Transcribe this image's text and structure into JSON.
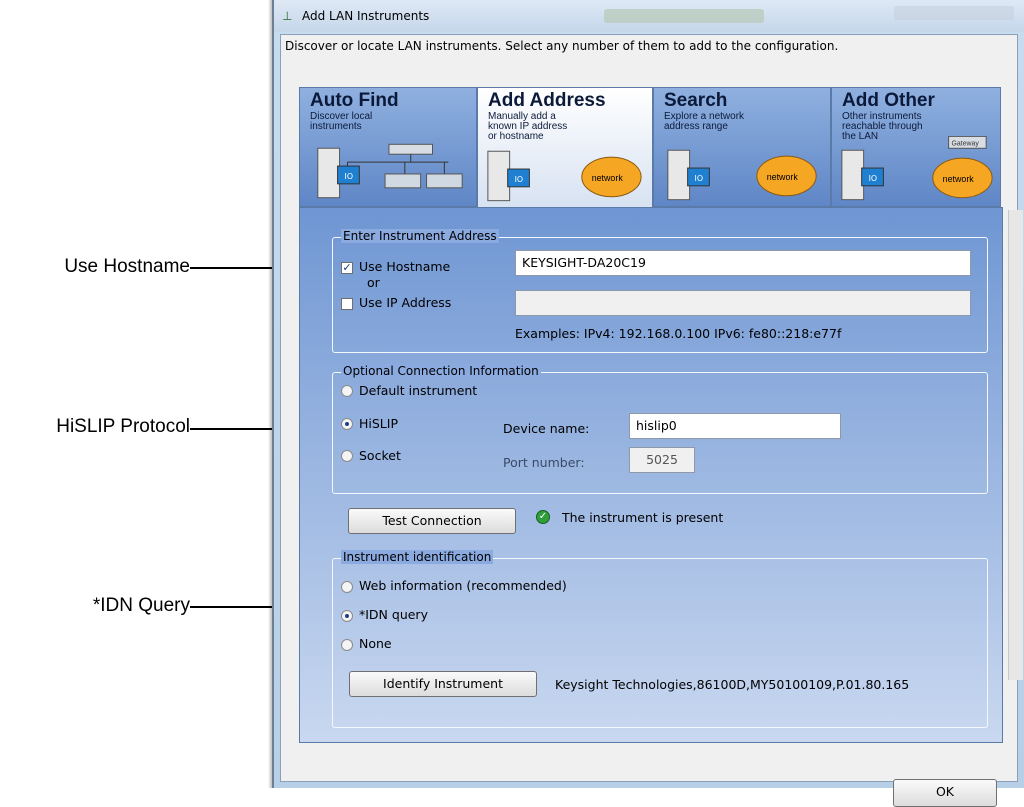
{
  "callouts": {
    "use_hostname": "Use Hostname",
    "hislip": "HiSLIP Protocol",
    "idn": "*IDN Query"
  },
  "window": {
    "title": "Add LAN Instruments",
    "description": "Discover or locate LAN instruments. Select any number of them to add to the configuration."
  },
  "tabs": [
    {
      "name": "Auto Find",
      "subtitle": "Discover local instruments",
      "icon": "auto-find-illustration"
    },
    {
      "name": "Add Address",
      "subtitle": "Manually add a known IP address or hostname",
      "icon": "add-address-illustration"
    },
    {
      "name": "Search",
      "subtitle": "Explore a network address range",
      "icon": "search-illustration"
    },
    {
      "name": "Add Other",
      "subtitle": "Other instruments reachable through the LAN",
      "icon": "add-other-illustration"
    }
  ],
  "illustration_labels": {
    "network": "network",
    "gateway": "Gateway",
    "io": "IO"
  },
  "address_group": {
    "title": "Enter Instrument Address",
    "use_hostname": "Use Hostname",
    "or": "or",
    "use_ip": "Use IP Address",
    "hostname_value": "KEYSIGHT-DA20C19",
    "ip_value": "",
    "examples": "Examples: IPv4: 192.168.0.100   IPv6: fe80::218:e77f"
  },
  "connection_group": {
    "title": "Optional Connection Information",
    "default": "Default instrument",
    "hislip": "HiSLIP",
    "socket": "Socket",
    "device_name_label": "Device name:",
    "device_name_value": "hislip0",
    "port_label": "Port number:",
    "port_value": "5025"
  },
  "test": {
    "button": "Test Connection",
    "status": "The instrument is present"
  },
  "identification_group": {
    "title": "Instrument identification",
    "web": "Web information (recommended)",
    "idn": "*IDN query",
    "none": "None",
    "identify_button": "Identify Instrument",
    "result": "Keysight Technologies,86100D,MY50100109,P.01.80.165"
  },
  "footer": {
    "ok": "OK"
  },
  "colors": {
    "panel_top": "#6f96d3",
    "tab_active": "#ffffff",
    "network_cloud": "#f5a623"
  }
}
